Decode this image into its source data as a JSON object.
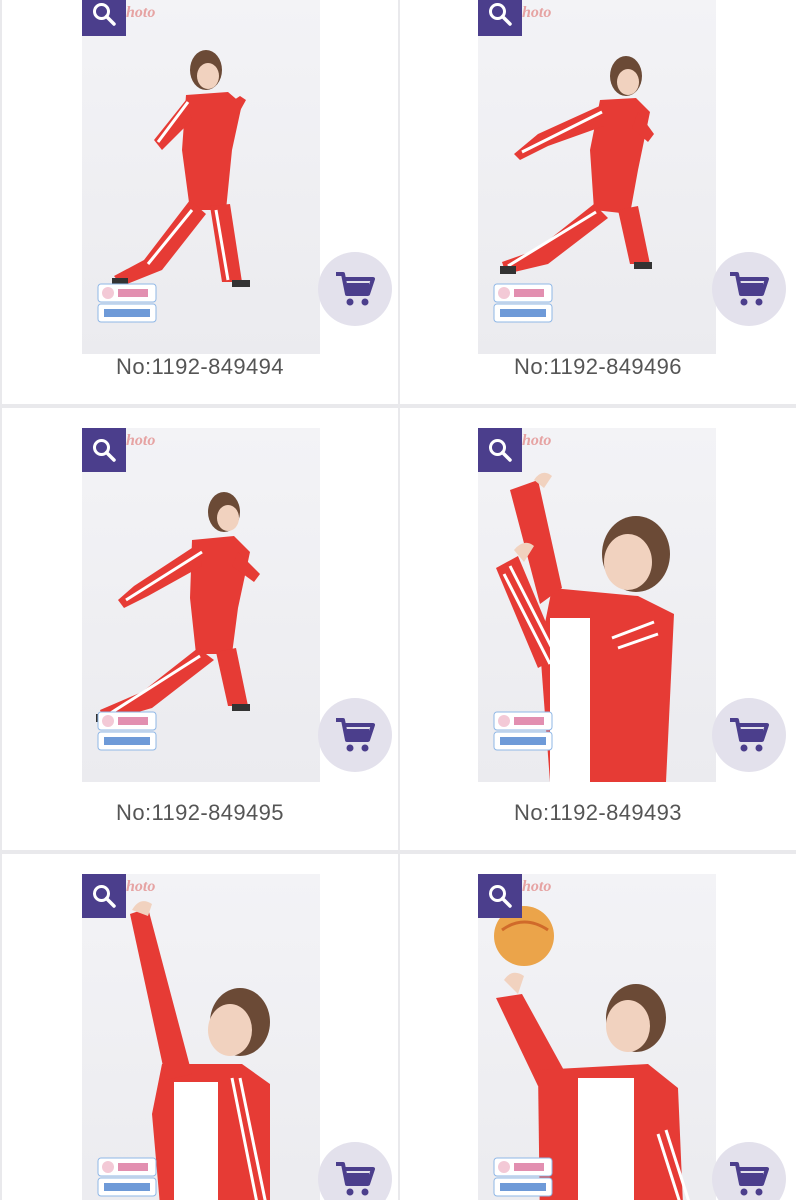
{
  "products": [
    {
      "number": "No:1192-849494"
    },
    {
      "number": "No:1192-849496"
    },
    {
      "number": "No:1192-849495"
    },
    {
      "number": "No:1192-849493"
    },
    {
      "number": ""
    },
    {
      "number": ""
    }
  ],
  "watermark_text": "hoto",
  "colors": {
    "accent": "#4b3e8c",
    "cart_bg": "#e3e1ec",
    "jacket": "#e63b35",
    "divider": "#e9e9ec"
  },
  "icons": {
    "zoom": "magnifier-icon",
    "cart": "shopping-cart-icon"
  }
}
